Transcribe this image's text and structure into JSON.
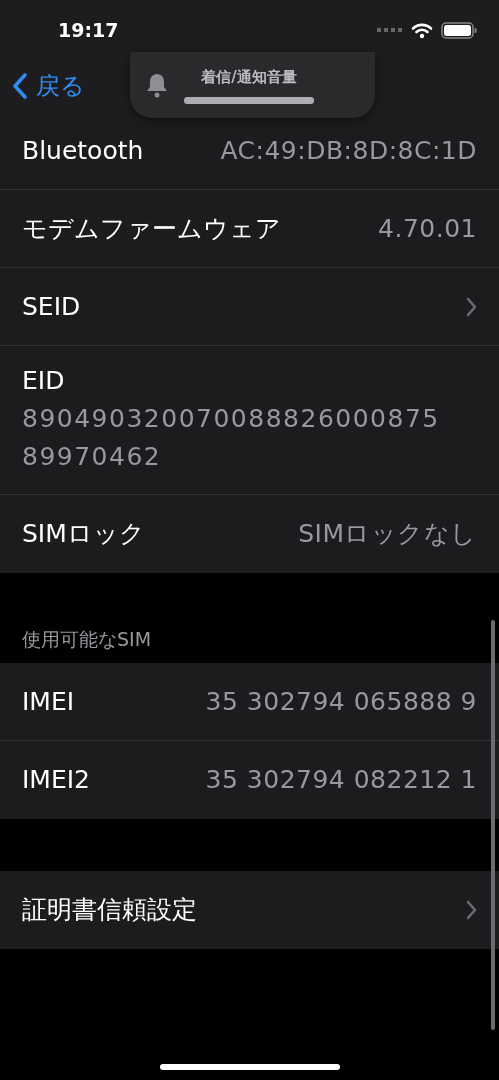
{
  "status_bar": {
    "time": "19:17"
  },
  "nav": {
    "back_label": "戻る"
  },
  "volume_hud": {
    "label": "着信/通知音量",
    "level": 1
  },
  "groups": [
    {
      "rows": [
        {
          "kind": "value",
          "label": "Bluetooth",
          "value": "AC:49:DB:8D:8C:1D"
        },
        {
          "kind": "value",
          "label": "モデムファームウェア",
          "value": "4.70.01"
        },
        {
          "kind": "chevron",
          "label": "SEID"
        },
        {
          "kind": "multiline",
          "label": "EID",
          "value_lines": [
            "890490320070088826000875",
            "89970462"
          ]
        },
        {
          "kind": "value",
          "label": "SIMロック",
          "value": "SIMロックなし"
        }
      ]
    },
    {
      "header": "使用可能なSIM",
      "rows": [
        {
          "kind": "value",
          "label": "IMEI",
          "value": "35 302794 065888 9"
        },
        {
          "kind": "value",
          "label": "IMEI2",
          "value": "35 302794 082212 1"
        }
      ]
    },
    {
      "rows": [
        {
          "kind": "chevron",
          "label": "証明書信頼設定"
        }
      ]
    }
  ]
}
